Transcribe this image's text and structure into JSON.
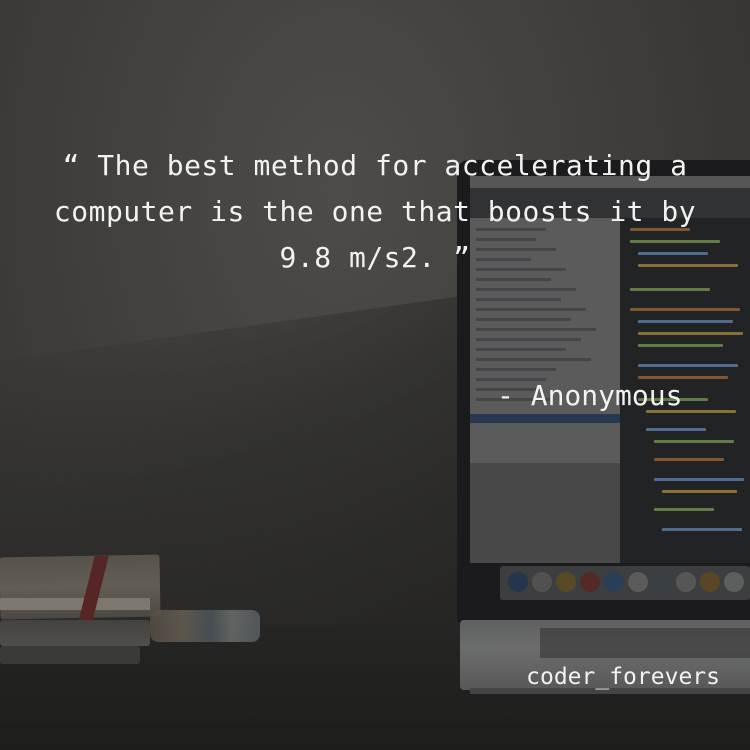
{
  "quote": {
    "line1": "“ The best method for accelerating a",
    "line2": "computer is the one that boosts it by",
    "line3": "9.8 m/s2. ”"
  },
  "author": "- Anonymous",
  "account_handle": "coder_forevers",
  "colors": {
    "text": "#f2f2f2",
    "wall": "#5f5c57",
    "desk": "#252523",
    "laptop_bezel": "#1a1b1d",
    "selection": "#3d73b4"
  }
}
